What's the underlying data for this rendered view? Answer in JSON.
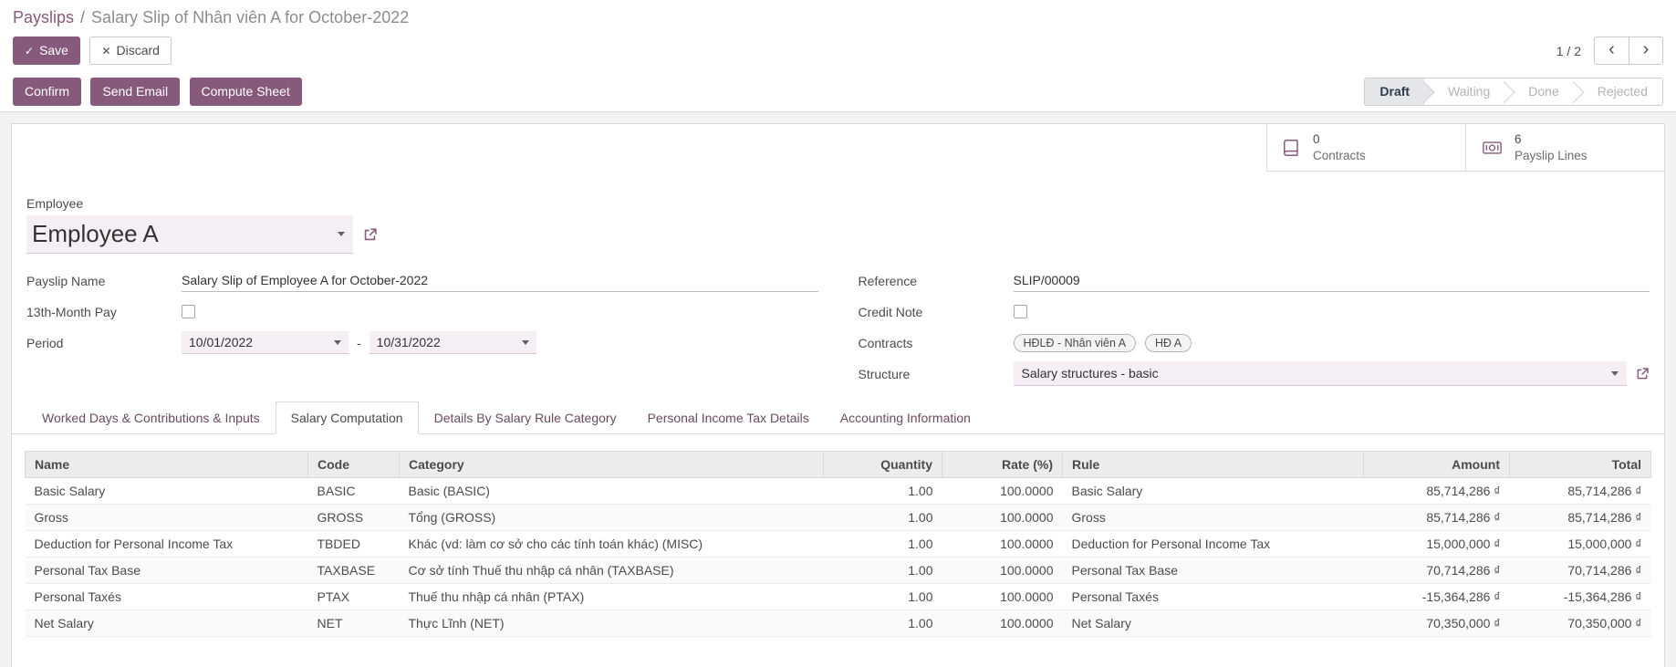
{
  "colors": {
    "primary": "#875A7B"
  },
  "breadcrumb": {
    "parent": "Payslips",
    "separator": "/",
    "current": "Salary Slip of Nhân viên A for October-2022"
  },
  "control_panel": {
    "save": "Save",
    "discard": "Discard",
    "pager": "1 / 2"
  },
  "actions": {
    "confirm": "Confirm",
    "send_email": "Send Email",
    "compute_sheet": "Compute Sheet"
  },
  "statusbar": {
    "states": [
      {
        "label": "Draft",
        "active": true
      },
      {
        "label": "Waiting",
        "active": false
      },
      {
        "label": "Done",
        "active": false
      },
      {
        "label": "Rejected",
        "active": false
      }
    ]
  },
  "stat_buttons": {
    "contracts": {
      "value": "0",
      "label": "Contracts"
    },
    "payslip_lines": {
      "value": "6",
      "label": "Payslip Lines"
    }
  },
  "form": {
    "employee": {
      "label": "Employee",
      "value": "Employee A"
    },
    "payslip_name": {
      "label": "Payslip Name",
      "value": "Salary Slip of Employee A for October-2022"
    },
    "thirteenth_month": {
      "label": "13th-Month Pay",
      "checked": false
    },
    "period": {
      "label": "Period",
      "from": "10/01/2022",
      "separator": "-",
      "to": "10/31/2022"
    },
    "reference": {
      "label": "Reference",
      "value": "SLIP/00009"
    },
    "credit_note": {
      "label": "Credit Note",
      "checked": false
    },
    "contracts": {
      "label": "Contracts",
      "tags": [
        "HĐLĐ - Nhân viên A",
        "HĐ A"
      ]
    },
    "structure": {
      "label": "Structure",
      "value": "Salary structures - basic"
    }
  },
  "tabs": [
    {
      "label": "Worked Days & Contributions & Inputs",
      "active": false
    },
    {
      "label": "Salary Computation",
      "active": true
    },
    {
      "label": "Details By Salary Rule Category",
      "active": false
    },
    {
      "label": "Personal Income Tax Details",
      "active": false
    },
    {
      "label": "Accounting Information",
      "active": false
    }
  ],
  "table": {
    "columns": [
      "Name",
      "Code",
      "Category",
      "Quantity",
      "Rate (%)",
      "Rule",
      "Amount",
      "Total"
    ],
    "rows": [
      [
        "Basic Salary",
        "BASIC",
        "Basic (BASIC)",
        "1.00",
        "100.0000",
        "Basic Salary",
        "85,714,286 ₫",
        "85,714,286 ₫"
      ],
      [
        "Gross",
        "GROSS",
        "Tổng (GROSS)",
        "1.00",
        "100.0000",
        "Gross",
        "85,714,286 ₫",
        "85,714,286 ₫"
      ],
      [
        "Deduction for Personal Income Tax",
        "TBDED",
        "Khác (vd: làm cơ sở cho các tính toán khác) (MISC)",
        "1.00",
        "100.0000",
        "Deduction for Personal Income Tax",
        "15,000,000 ₫",
        "15,000,000 ₫"
      ],
      [
        "Personal Tax Base",
        "TAXBASE",
        "Cơ sở tính Thuế thu nhập cá nhân (TAXBASE)",
        "1.00",
        "100.0000",
        "Personal Tax Base",
        "70,714,286 ₫",
        "70,714,286 ₫"
      ],
      [
        "Personal Taxés",
        "PTAX",
        "Thuế thu nhập cá nhân (PTAX)",
        "1.00",
        "100.0000",
        "Personal Taxés",
        "-15,364,286 ₫",
        "-15,364,286 ₫"
      ],
      [
        "Net Salary",
        "NET",
        "Thực Lĩnh (NET)",
        "1.00",
        "100.0000",
        "Net Salary",
        "70,350,000 ₫",
        "70,350,000 ₫"
      ]
    ]
  }
}
